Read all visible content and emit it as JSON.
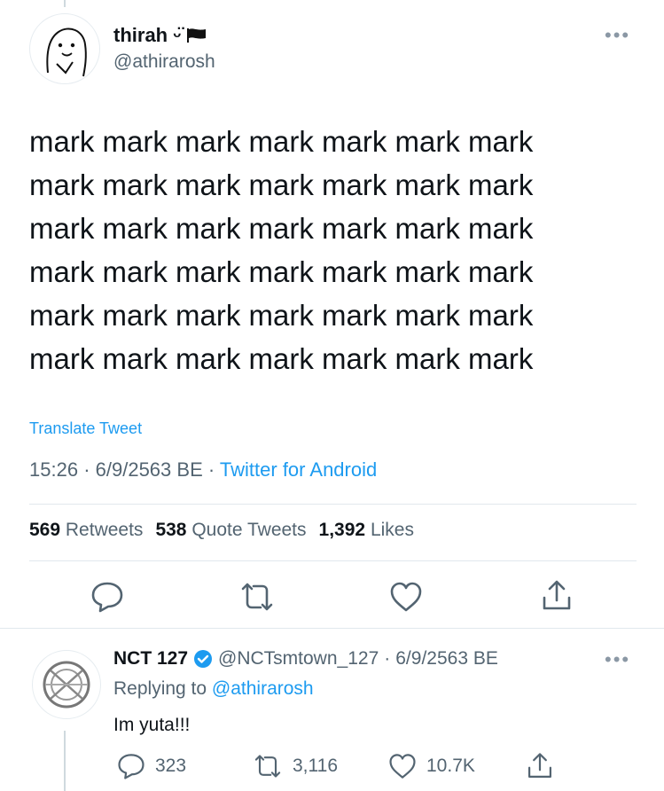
{
  "tweet": {
    "author_name": "thirah ᵕ̈",
    "handle": "@athirarosh",
    "more_label": "•••",
    "text_lines": [
      "mark mark mark mark mark mark mark",
      "mark mark mark mark mark mark mark",
      "mark mark mark mark mark mark mark",
      "mark mark mark mark mark mark mark",
      "mark mark mark mark mark mark mark",
      "mark mark mark mark mark mark mark"
    ],
    "translate_label": "Translate Tweet",
    "time": "15:26",
    "date": "6/9/2563 BE",
    "source": "Twitter for Android",
    "retweets_count": "569",
    "retweets_label": "Retweets",
    "quote_count": "538",
    "quote_label": "Quote Tweets",
    "likes_count": "1,392",
    "likes_label": "Likes",
    "action_icons": [
      "reply-icon",
      "retweet-icon",
      "like-icon",
      "share-icon"
    ]
  },
  "reply": {
    "author_name": "NCT 127",
    "verified": true,
    "handle": "@NCTsmtown_127",
    "date": "6/9/2563 BE",
    "more_label": "•••",
    "replying_prefix": "Replying to",
    "replying_to": "@athirarosh",
    "text": "Im yuta!!!",
    "reply_count": "323",
    "retweet_count": "3,116",
    "like_count": "10.7K"
  },
  "colors": {
    "link": "#1d9bf0",
    "secondary_text": "#536471",
    "primary_text": "#0f1419",
    "divider": "#e1e8ed"
  }
}
